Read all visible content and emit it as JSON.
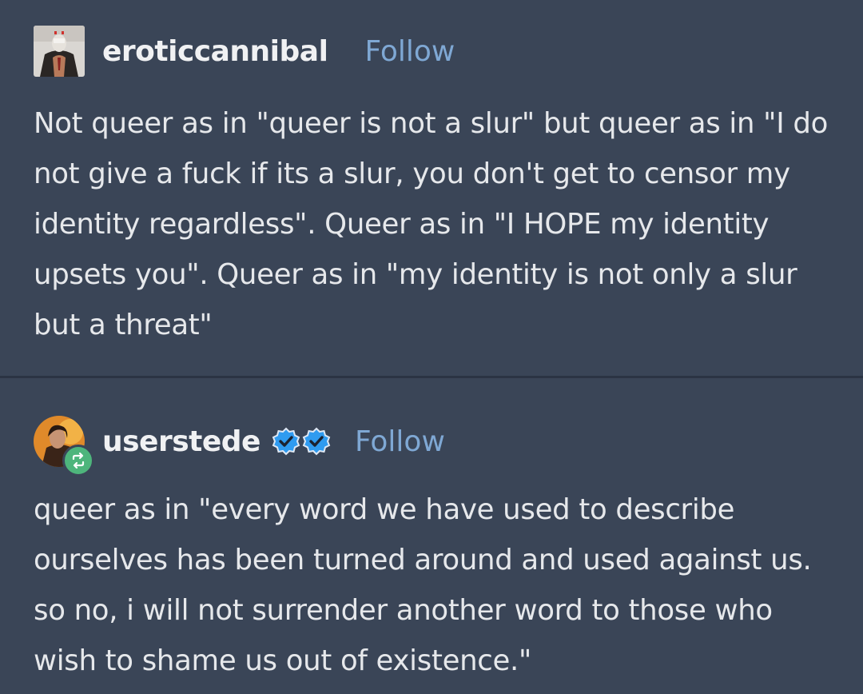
{
  "posts": [
    {
      "username": "eroticcannibal",
      "follow_label": "Follow",
      "text": "Not queer as in \"queer is not a slur\" but queer as in \"I do not give a fuck if its a slur, you don't get to censor my identity regardless\". Queer as in \"I HOPE my identity upsets you\". Queer as in \"my identity is not only a slur but a threat\""
    },
    {
      "username": "userstede",
      "follow_label": "Follow",
      "text": "queer as in \"every word we have used to describe ourselves has been turned around and used against us. so no, i will not surrender another word to those who wish to shame us out of existence.\""
    }
  ],
  "colors": {
    "background": "#3a4557",
    "follow": "#7fa8d4",
    "verified": "#2f9bf0",
    "reblog": "#4eb57c"
  }
}
